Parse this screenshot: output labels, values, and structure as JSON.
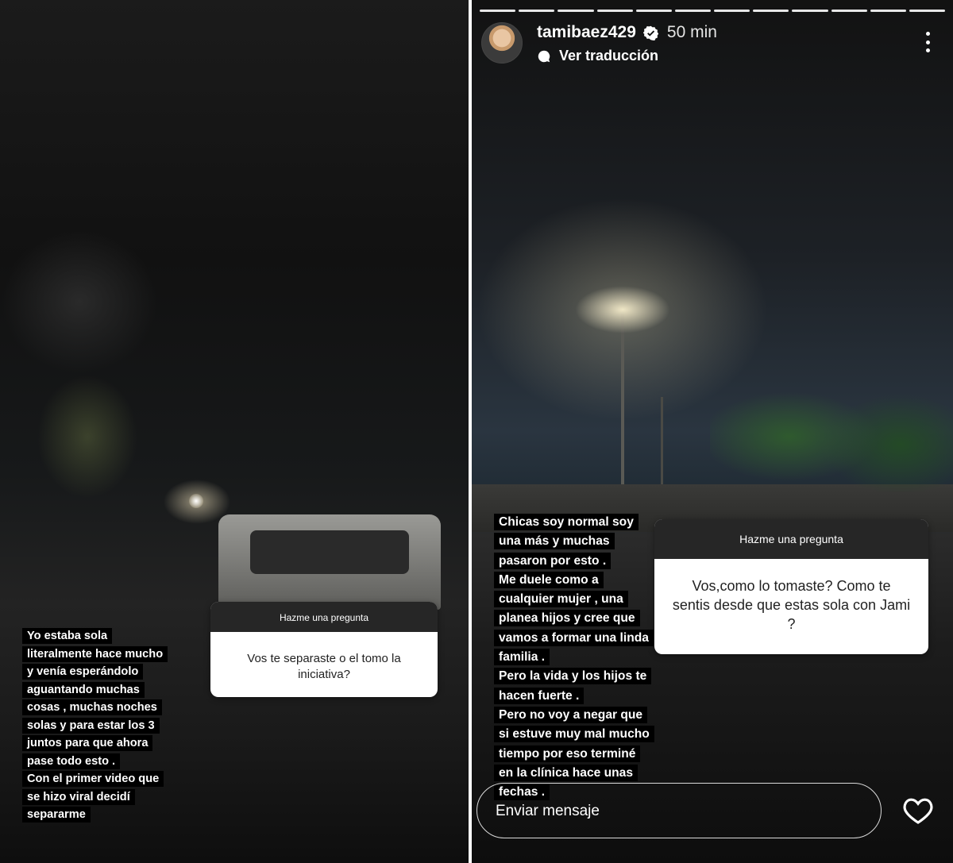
{
  "left_story": {
    "question_sticker": {
      "header": "Hazme una pregunta",
      "question": "Vos te separaste o el tomo la iniciativa?"
    },
    "caption_lines": [
      "Yo estaba sola",
      "literalmente hace mucho",
      "y venía esperándolo",
      "aguantando muchas",
      "cosas , muchas noches",
      "solas y para estar los 3",
      "juntos para que ahora",
      "pase todo esto .",
      "Con el primer video que",
      "se hizo viral decidí",
      "separarme"
    ]
  },
  "right_story": {
    "progress_segments": 12,
    "header": {
      "username": "tamibaez429",
      "verified_icon": "verified-badge-icon",
      "time_ago": "50 min",
      "translate_label": "Ver traducción",
      "translate_icon": "speech-bubble-icon",
      "more_icon": "more-vertical-icon"
    },
    "question_sticker": {
      "header": "Hazme una pregunta",
      "question": "Vos,como lo tomaste? Como te sentis desde que estas sola con Jami ?"
    },
    "caption_lines": [
      "Chicas soy normal soy",
      "una más y muchas",
      "pasaron por esto .",
      "Me duele como a",
      "cualquier mujer , una",
      "planea hijos y cree que",
      "vamos a formar una linda",
      "familia .",
      "Pero la vida y los hijos te",
      "hacen fuerte .",
      "Pero no voy a negar que",
      "si estuve muy mal mucho",
      "tiempo por eso terminé",
      "en la clínica hace unas",
      "fechas ."
    ],
    "reply": {
      "placeholder": "Enviar mensaje",
      "like_icon": "heart-icon"
    }
  },
  "colors": {
    "sticker_header_bg": "#262626",
    "text_highlight": "#000000",
    "text": "#ffffff"
  }
}
